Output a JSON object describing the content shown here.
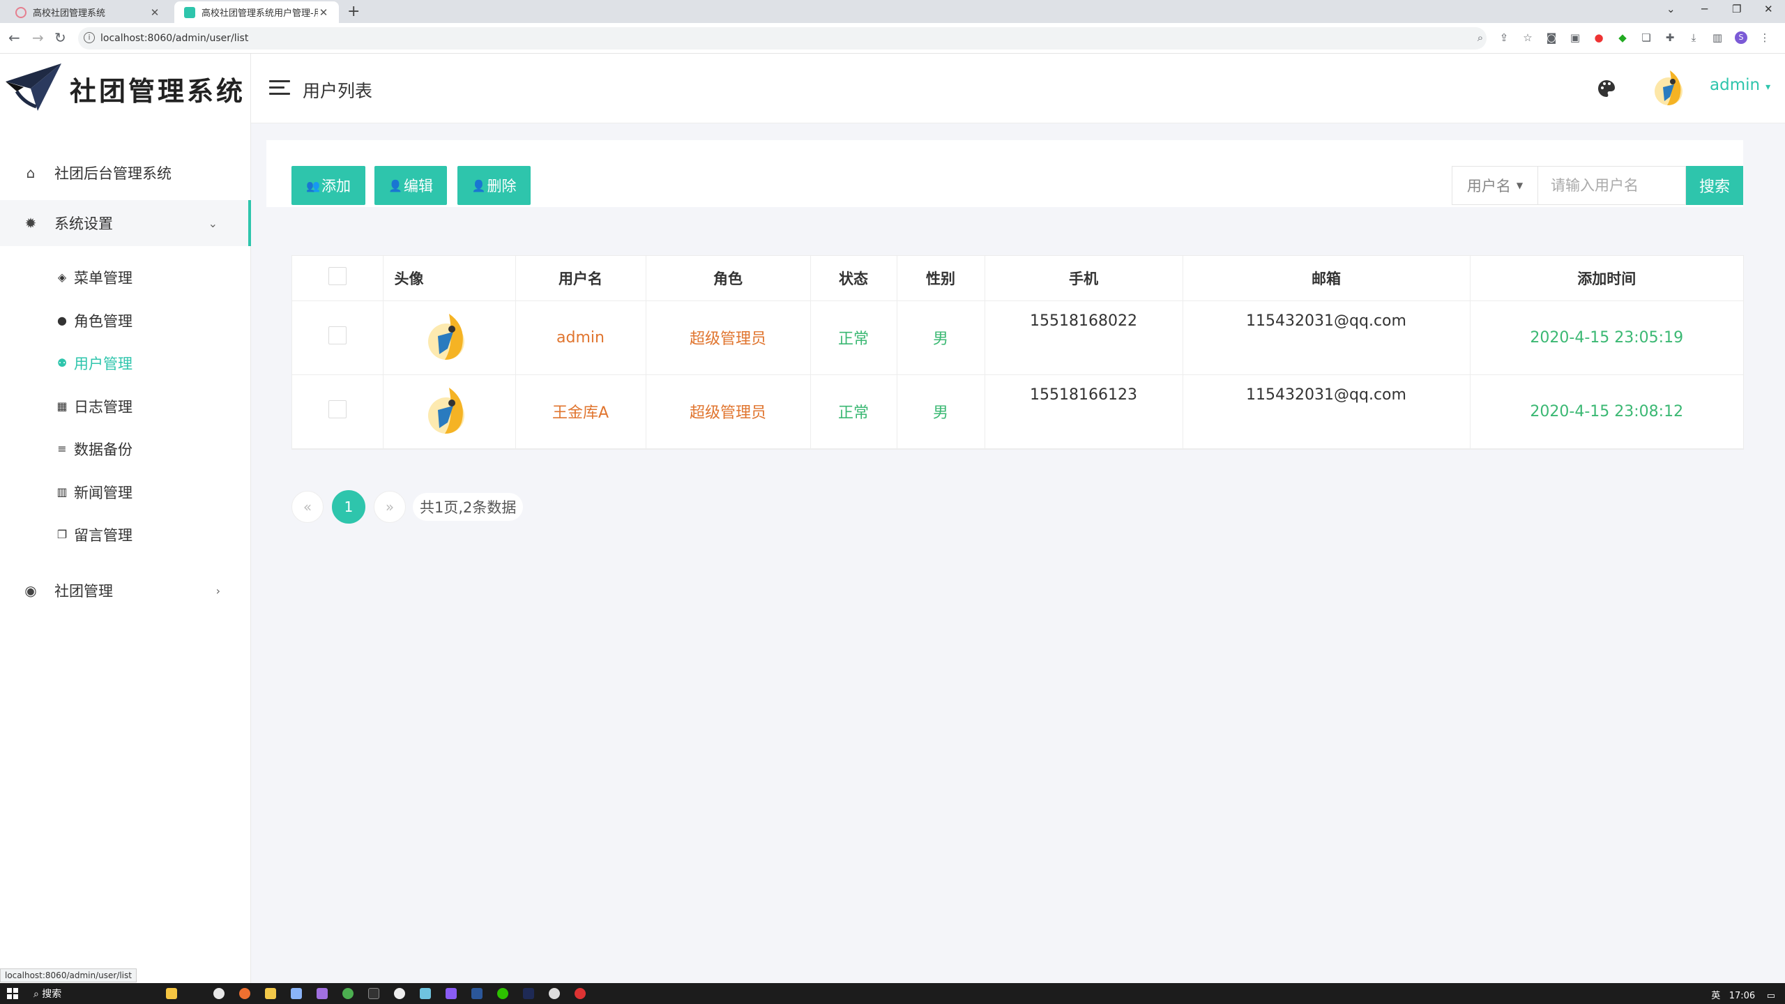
{
  "browser": {
    "tabs": [
      {
        "title": "高校社团管理系统"
      },
      {
        "title": "高校社团管理系统用户管理-用户"
      }
    ],
    "url": "localhost:8060/admin/user/list",
    "status_url": "localhost:8060/admin/user/list"
  },
  "sidebar": {
    "brand": "社团管理系统",
    "items": [
      {
        "label": "社团后台管理系统",
        "icon": "home-icon"
      },
      {
        "label": "系统设置",
        "icon": "gear-icon"
      },
      {
        "label": "社团管理",
        "icon": "rocket-icon"
      }
    ],
    "sub_items": [
      {
        "label": "菜单管理",
        "icon": "layers-icon"
      },
      {
        "label": "角色管理",
        "icon": "user-icon"
      },
      {
        "label": "用户管理",
        "icon": "users-icon"
      },
      {
        "label": "日志管理",
        "icon": "calendar-icon"
      },
      {
        "label": "数据备份",
        "icon": "database-icon"
      },
      {
        "label": "新闻管理",
        "icon": "book-icon"
      },
      {
        "label": "留言管理",
        "icon": "notes-icon"
      }
    ]
  },
  "header": {
    "title": "用户列表",
    "user": "admin"
  },
  "toolbar": {
    "add_label": "添加",
    "edit_label": "编辑",
    "delete_label": "删除",
    "search_field": "用户名",
    "search_placeholder": "请输入用户名",
    "search_button": "搜索"
  },
  "table": {
    "columns": [
      "头像",
      "用户名",
      "角色",
      "状态",
      "性别",
      "手机",
      "邮箱",
      "添加时间"
    ],
    "rows": [
      {
        "username": "admin",
        "role": "超级管理员",
        "status": "正常",
        "gender": "男",
        "phone": "15518168022",
        "email": "115432031@qq.com",
        "created": "2020-4-15 23:05:19"
      },
      {
        "username": "王金库A",
        "role": "超级管理员",
        "status": "正常",
        "gender": "男",
        "phone": "15518166123",
        "email": "115432031@qq.com",
        "created": "2020-4-15 23:08:12"
      }
    ]
  },
  "pagination": {
    "prev": "«",
    "current": "1",
    "next": "»",
    "info": "共1页,2条数据"
  },
  "taskbar": {
    "search": "搜索",
    "time": "17:06",
    "lang": "英"
  },
  "colors": {
    "accent": "#2ec5ac",
    "orange": "#e0752f",
    "green": "#3bb873"
  }
}
